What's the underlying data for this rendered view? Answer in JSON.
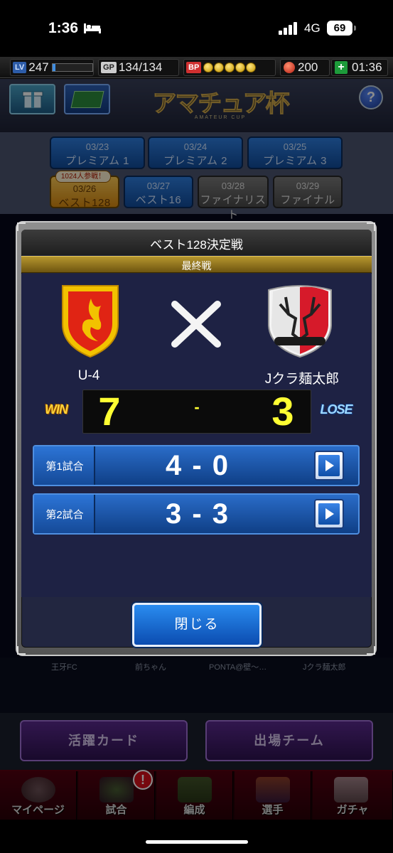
{
  "status_bar": {
    "time": "1:36",
    "network": "4G",
    "battery": "69"
  },
  "top_bar": {
    "lv_tag": "LV",
    "level": "247",
    "level_progress": 0.08,
    "gp_tag": "GP",
    "gp": "134/134",
    "bp_tag": "BP",
    "ball_count": "200",
    "timer": "01:36"
  },
  "header": {
    "logo_text": "アマチュア杯",
    "logo_sub": "AMATEUR CUP",
    "help": "?"
  },
  "rounds": [
    {
      "date": "03/23",
      "name": "プレミアム 1"
    },
    {
      "date": "03/24",
      "name": "プレミアム 2"
    },
    {
      "date": "03/25",
      "name": "プレミアム 3"
    },
    {
      "date": "03/26",
      "name": "ベスト128"
    },
    {
      "date": "03/27",
      "name": "ベスト16"
    },
    {
      "date": "03/28",
      "name": "ファイナリスト"
    },
    {
      "date": "03/29",
      "name": "ファイナル"
    }
  ],
  "participants_badge": "1024人参戦！",
  "dialog": {
    "title": "ベスト128決定戦",
    "subtitle": "最終戦",
    "team_left": "U-4",
    "team_right": "Jクラ麺太郎",
    "score_left": "7",
    "score_right": "3",
    "score_sep": "-",
    "result_left": "WIN",
    "result_right": "LOSE",
    "games": [
      {
        "label": "第1試合",
        "score": "4 - 0"
      },
      {
        "label": "第2試合",
        "score": "3 - 3"
      }
    ],
    "close_label": "閉じる"
  },
  "rank_names": [
    "王牙FC",
    "前ちゃん",
    "PONTA@壁～…",
    "Jクラ麺太郎"
  ],
  "bottom_buttons": {
    "active_cards": "活躍カード",
    "team": "出場チーム"
  },
  "tabs": [
    {
      "label": "マイページ"
    },
    {
      "label": "試合"
    },
    {
      "label": "編成"
    },
    {
      "label": "選手"
    },
    {
      "label": "ガチャ"
    }
  ],
  "alert_badge": "!"
}
